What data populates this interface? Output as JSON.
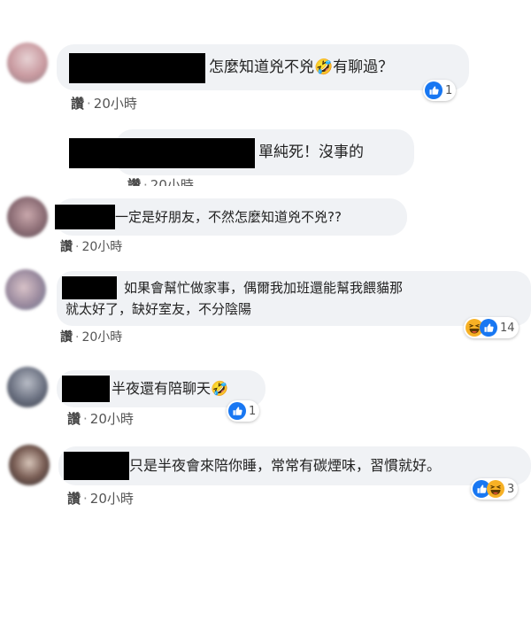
{
  "comments": [
    {
      "text": "怎麼知道兇不兇🤣有聊過？",
      "like_label": "讚",
      "time": "20小時",
      "reactions": {
        "icons": [
          "like-icon"
        ],
        "count": "1"
      },
      "replies": [
        {
          "text": "單純死！沒事的",
          "like_label": "讚",
          "time": "20小時"
        }
      ]
    },
    {
      "text": "一定是好朋友，不然怎麼知道兇不兇??",
      "like_label": "讚",
      "time": "20小時"
    },
    {
      "text": "如果會幫忙做家事，偶爾我加班還能幫我餵貓那就太好了，缺好室友，不分陰陽",
      "like_label": "讚",
      "time": "20小時",
      "reactions": {
        "icons": [
          "haha-icon",
          "like-icon"
        ],
        "count": "14"
      }
    },
    {
      "text": "半夜還有陪聊天🤣",
      "like_label": "讚",
      "time": "20小時",
      "reactions": {
        "icons": [
          "like-icon"
        ],
        "count": "1"
      }
    },
    {
      "text": "只是半夜會來陪你睡，常常有碳煙味，習慣就好。",
      "like_label": "讚",
      "time": "20小時",
      "reactions": {
        "icons": [
          "like-icon",
          "haha-icon"
        ],
        "count": "3"
      }
    }
  ],
  "separator": "·",
  "colors": {
    "bubble": "#f0f2f5",
    "like_blue": "#1877f2",
    "haha_yellow": "#f7b125"
  }
}
